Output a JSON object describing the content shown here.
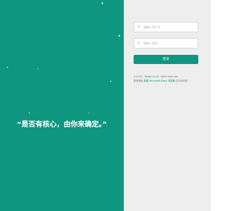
{
  "theme": {
    "accent": "#0e9680",
    "panel_bg": "#eeeeee"
  },
  "hero": {
    "slogan": "“是否有核心，由你来确定。”",
    "sparkle_glyph": "✦"
  },
  "login": {
    "username": {
      "icon": "user-icon",
      "glyph": "♙",
      "placeholder": "请输入用户名",
      "value": ""
    },
    "password": {
      "icon": "lock-icon",
      "glyph": "⌂",
      "placeholder": "请输入密码",
      "value": ""
    },
    "submit_label": "登录"
  },
  "footer": {
    "copyright_prefix": "©2020 - ",
    "company": "Tongo Co",
    "copyright_suffix": " All rights reserved",
    "browser_prefix": "推荐使用 ",
    "browser_link": "新版 Microsoft Edge 浏览器",
    "browser_suffix": " 访问本系统"
  }
}
